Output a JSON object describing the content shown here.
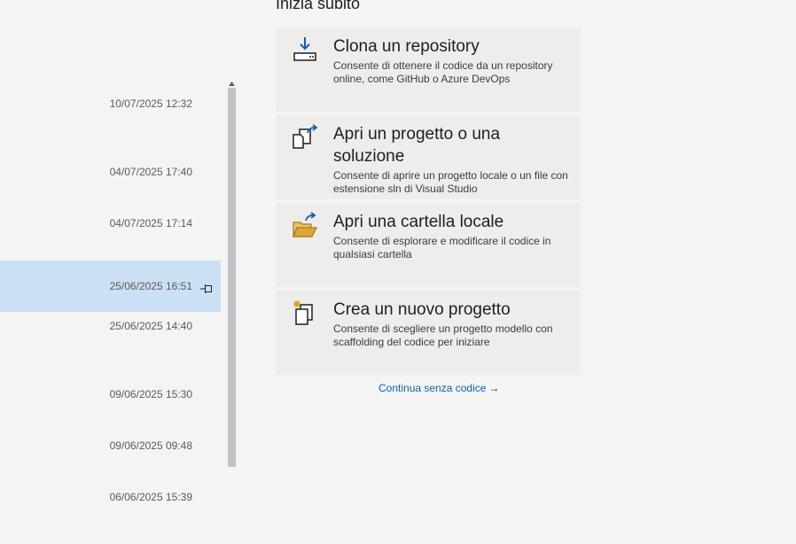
{
  "start": {
    "title": "Inizia subito",
    "cards": [
      {
        "title": "Clona un repository",
        "desc": "Consente di ottenere il codice da un repository online, come GitHub o Azure DevOps",
        "icon": "clone-download-icon"
      },
      {
        "title": "Apri un progetto o una soluzione",
        "desc": "Consente di aprire un progetto locale o un file con estensione sln di Visual Studio",
        "icon": "open-project-icon"
      },
      {
        "title": "Apri una cartella locale",
        "desc": "Consente di esplorare e modificare il codice in qualsiasi cartella",
        "icon": "open-folder-icon"
      },
      {
        "title": "Crea un nuovo progetto",
        "desc": "Consente di scegliere un progetto modello con scaffolding del codice per iniziare",
        "icon": "new-project-icon"
      }
    ],
    "continue_label": "Continua senza codice",
    "continue_arrow": "→"
  },
  "recent": {
    "items": [
      {
        "date": "10/07/2025 12:32",
        "selected": false
      },
      {
        "date": "04/07/2025 17:40",
        "selected": false
      },
      {
        "date": "04/07/2025 17:14",
        "selected": false
      },
      {
        "date": "25/06/2025 16:51",
        "selected": true
      },
      {
        "date": "25/06/2025 14:40",
        "selected": false
      },
      {
        "date": "09/06/2025 15:30",
        "selected": false
      },
      {
        "date": "09/06/2025 09:48",
        "selected": false
      },
      {
        "date": "06/06/2025 15:39",
        "selected": false
      }
    ]
  },
  "colors": {
    "accent": "#1561a9",
    "selection": "#cce0f5",
    "card_bg": "#eeedeb",
    "folder": "#d8a93a"
  }
}
